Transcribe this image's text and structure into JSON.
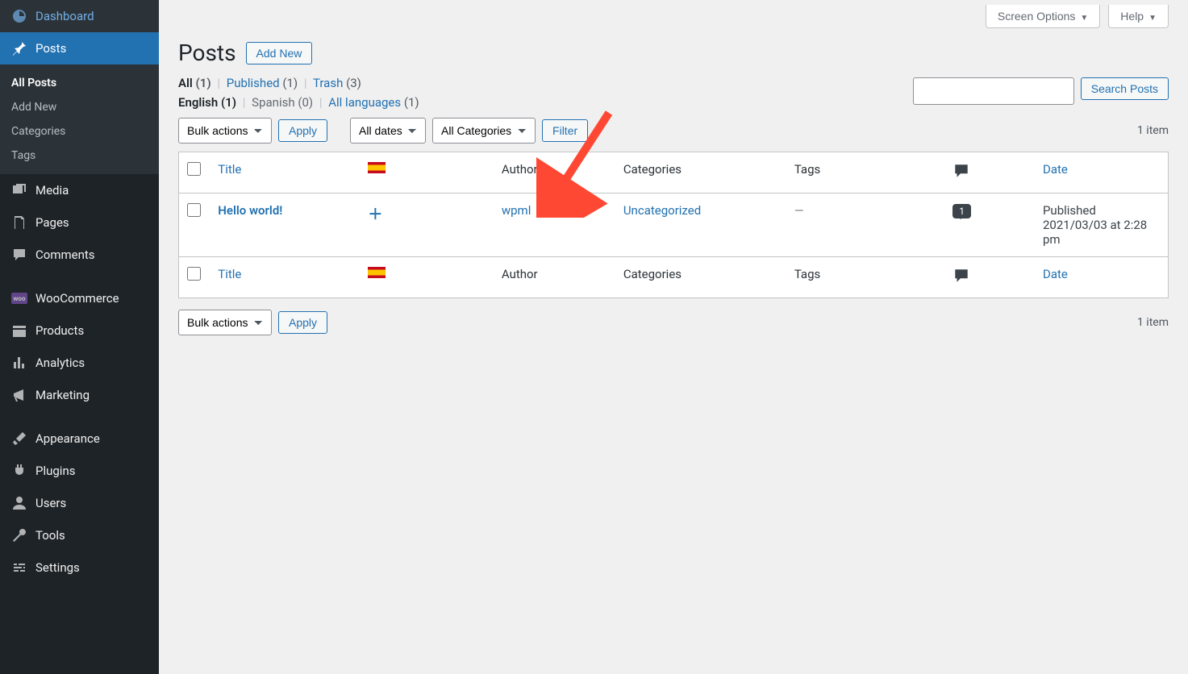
{
  "screen_meta": {
    "screen_options": "Screen Options",
    "help": "Help"
  },
  "sidebar": {
    "items": [
      {
        "label": "Dashboard",
        "icon": "dashboard"
      },
      {
        "label": "Posts",
        "icon": "pin"
      },
      {
        "label": "Media",
        "icon": "media"
      },
      {
        "label": "Pages",
        "icon": "pages"
      },
      {
        "label": "Comments",
        "icon": "comment"
      },
      {
        "label": "WooCommerce",
        "icon": "woo"
      },
      {
        "label": "Products",
        "icon": "products"
      },
      {
        "label": "Analytics",
        "icon": "analytics"
      },
      {
        "label": "Marketing",
        "icon": "marketing"
      },
      {
        "label": "Appearance",
        "icon": "appearance"
      },
      {
        "label": "Plugins",
        "icon": "plugins"
      },
      {
        "label": "Users",
        "icon": "users"
      },
      {
        "label": "Tools",
        "icon": "tools"
      },
      {
        "label": "Settings",
        "icon": "settings"
      }
    ],
    "submenu": [
      {
        "label": "All Posts"
      },
      {
        "label": "Add New"
      },
      {
        "label": "Categories"
      },
      {
        "label": "Tags"
      }
    ]
  },
  "header": {
    "title": "Posts",
    "add_new": "Add New"
  },
  "status_filters": {
    "all": "All",
    "all_count": "(1)",
    "published": "Published",
    "published_count": "(1)",
    "trash": "Trash",
    "trash_count": "(3)"
  },
  "lang_filters": {
    "english": "English (1)",
    "spanish": "Spanish (0)",
    "all": "All languages",
    "all_count": "(1)"
  },
  "toolbar": {
    "bulk_actions": "Bulk actions",
    "apply": "Apply",
    "all_dates": "All dates",
    "all_categories": "All Categories",
    "filter": "Filter",
    "item_count": "1 item"
  },
  "search": {
    "button": "Search Posts",
    "value": ""
  },
  "columns": {
    "title": "Title",
    "author": "Author",
    "categories": "Categories",
    "tags": "Tags",
    "date": "Date"
  },
  "row": {
    "title": "Hello world!",
    "author": "wpml",
    "categories": "Uncategorized",
    "tags": "—",
    "comments": "1",
    "date_status": "Published",
    "date_value": "2021/03/03 at 2:28 pm"
  }
}
